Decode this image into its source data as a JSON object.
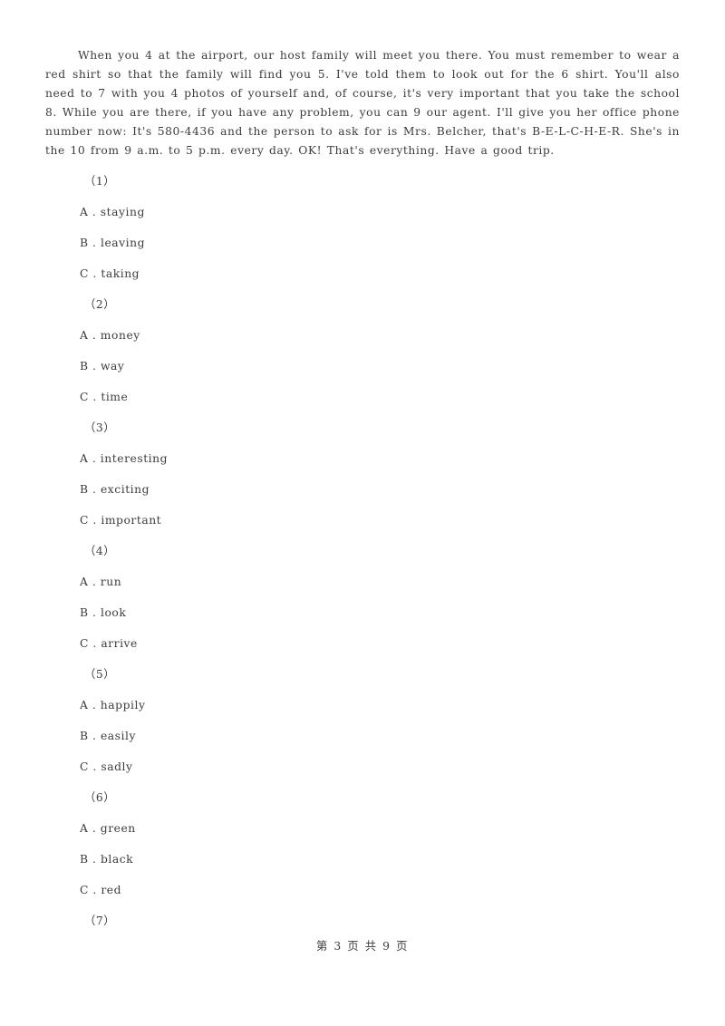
{
  "document": {
    "page_label": "第 3 页 共 9 页",
    "passage_text": "When you 4 at the airport, our host family will meet you there. You must remember to wear a red shirt so that the family will find you 5. I've told them to look out for the 6 shirt. You'll also need to 7 with you 4 photos of yourself and, of course, it's very important that you take the school 8. While you are there, if you have any problem, you can 9 our agent. I'll give you her office phone number now: It's 580-4436 and the person to ask for is Mrs. Belcher, that's B-E-L-C-H-E-R. She's in the 10 from 9 a.m. to 5 p.m. every day. OK! That's everything. Have a good trip."
  },
  "questions": [
    {
      "number": "（1）",
      "options": [
        "A . staying",
        "B . leaving",
        "C . taking"
      ]
    },
    {
      "number": "（2）",
      "options": [
        "A . money",
        "B . way",
        "C . time"
      ]
    },
    {
      "number": "（3）",
      "options": [
        "A . interesting",
        "B . exciting",
        "C . important"
      ]
    },
    {
      "number": "（4）",
      "options": [
        "A . run",
        "B . look",
        "C . arrive"
      ]
    },
    {
      "number": "（5）",
      "options": [
        "A . happily",
        "B . easily",
        "C . sadly"
      ]
    },
    {
      "number": "（6）",
      "options": [
        "A . green",
        "B . black",
        "C . red"
      ]
    },
    {
      "number": "（7）",
      "options": []
    }
  ]
}
